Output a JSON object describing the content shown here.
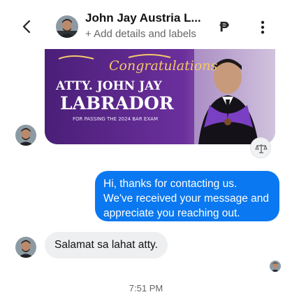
{
  "header": {
    "contact_name": "John Jay Austria L...",
    "subtitle": "+ Add details and labels",
    "currency_symbol": "₱"
  },
  "banner": {
    "script_title": "Congratulations",
    "name_line1": "ATTY. JOHN JAY",
    "name_line2": "LABRADOR",
    "caption": "FOR PASSING THE 2024 BAR EXAM"
  },
  "messages": [
    {
      "direction": "outgoing",
      "lines": [
        "Hi, thanks for contacting us.",
        "We've received your message and",
        "appreciate you reaching out."
      ]
    },
    {
      "direction": "incoming",
      "text": "Salamat sa lahat atty."
    }
  ],
  "timestamp": "7:51 PM",
  "colors": {
    "accent": "#0a78f0",
    "banner_purple": "#5a2a8a",
    "incoming_bubble": "#eeeff1"
  },
  "icons": [
    "back-arrow-icon",
    "peso-icon",
    "more-vertical-icon",
    "scales-icon"
  ]
}
